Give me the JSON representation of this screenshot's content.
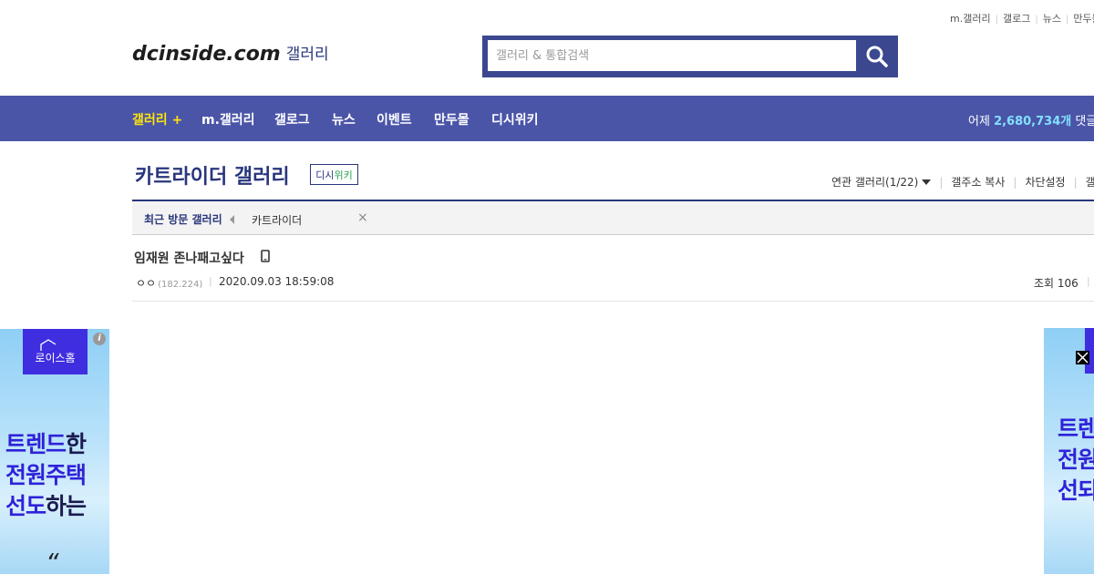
{
  "top_links": [
    "m.갤러리",
    "갤로그",
    "뉴스",
    "만두몰"
  ],
  "logo": {
    "main": "dcinside.com",
    "sub": "갤러리"
  },
  "search": {
    "placeholder": "갤러리 & 통합검색"
  },
  "nav": {
    "items": [
      "갤러리 +",
      "m.갤러리",
      "갤로그",
      "뉴스",
      "이벤트",
      "만두몰",
      "디시위키"
    ],
    "stats_prefix": "어제",
    "stats_value": "2,680,734개",
    "stats_suffix": "댓글"
  },
  "gallery": {
    "title": "카트라이더 갤러리",
    "wiki_badge_a": "디시",
    "wiki_badge_b": "위키",
    "tools": {
      "related": "연관 갤러리(1/22)",
      "copy": "갤주소 복사",
      "block": "차단설정",
      "more": "갤러"
    }
  },
  "recent": {
    "label": "최근 방문 갤러리",
    "item": "카트라이더",
    "close": "×"
  },
  "post": {
    "title": "임재원 존나패고싶다",
    "author": "ㅇㅇ",
    "ip": "(182.224)",
    "date": "2020.09.03 18:59:08",
    "views": "조회 106"
  },
  "ads": {
    "left": {
      "brand": "로이스홈",
      "brand_tag": "전원주택 선도",
      "line1a": "트렌드",
      "line1b": "한",
      "line2": "전원주택",
      "line3a": "선도",
      "line3b": "하는",
      "quote": "“"
    },
    "right": {
      "line1": "트렌",
      "line2": "전원",
      "line3": "선되"
    }
  },
  "colors": {
    "brand_blue": "#29367c",
    "nav_bg": "#4a55a8",
    "nav_active": "#ffe40b",
    "stats_num": "#83e0ff"
  }
}
